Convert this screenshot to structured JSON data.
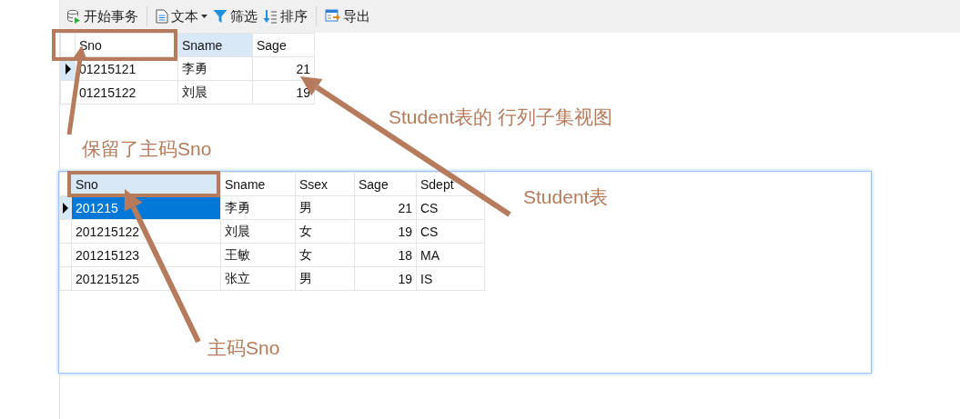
{
  "toolbar": {
    "groups": [
      [
        {
          "label": "开始事务",
          "kind": "button"
        }
      ],
      [
        {
          "label": "文本",
          "kind": "dropdown"
        },
        {
          "label": "筛选",
          "kind": "button"
        },
        {
          "label": "排序",
          "kind": "button"
        }
      ],
      [
        {
          "label": "导出",
          "kind": "button"
        }
      ]
    ]
  },
  "tables": [
    {
      "focused": false,
      "columns": [
        {
          "label": "Sno",
          "selected": false,
          "kind": "text"
        },
        {
          "label": "Sname",
          "selected": true,
          "kind": "text"
        },
        {
          "label": "Sage",
          "selected": false,
          "kind": "number"
        }
      ],
      "rows": [
        {
          "current": true,
          "cells": [
            "01215121",
            "李勇",
            "21"
          ]
        },
        {
          "current": false,
          "cells": [
            "01215122",
            "刘晨",
            "19"
          ]
        }
      ]
    },
    {
      "focused": true,
      "columns": [
        {
          "label": "Sno",
          "selected": true,
          "kind": "text"
        },
        {
          "label": "Sname",
          "selected": false,
          "kind": "text"
        },
        {
          "label": "Ssex",
          "selected": false,
          "kind": "text"
        },
        {
          "label": "Sage",
          "selected": false,
          "kind": "number"
        },
        {
          "label": "Sdept",
          "selected": false,
          "kind": "text"
        }
      ],
      "rows": [
        {
          "current": true,
          "cells": [
            "201215",
            "李勇",
            "男",
            "21",
            "CS"
          ]
        },
        {
          "current": false,
          "cells": [
            "201215122",
            "刘晨",
            "女",
            "19",
            "CS"
          ]
        },
        {
          "current": false,
          "cells": [
            "201215123",
            "王敏",
            "女",
            "18",
            "MA"
          ]
        },
        {
          "current": false,
          "cells": [
            "201215125",
            "张立",
            "男",
            "19",
            "IS"
          ]
        }
      ]
    }
  ],
  "callouts": [
    "Student表的 行列子集视图",
    "保留了主码Sno",
    "Student表",
    "主码Sno"
  ]
}
